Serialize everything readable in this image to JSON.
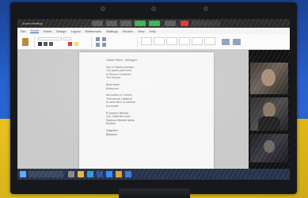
{
  "zoom": {
    "meeting_title": "Zoom Meeting",
    "controls": [
      "mute-icon",
      "video-icon",
      "participants-icon",
      "share-screen-icon",
      "record-icon",
      "end-icon"
    ],
    "colors": {
      "share": "#2fb34a",
      "end": "#d9362b",
      "bar": "#2a2a2a"
    }
  },
  "word": {
    "tabs": [
      "File",
      "Home",
      "Insert",
      "Design",
      "Layout",
      "References",
      "Mailings",
      "Review",
      "View",
      "Help"
    ],
    "active_tab": "Home",
    "document_lines": [
      "Cillard Street , Mettogen . .",
      "",
      "Sun in Winternoonsse",
      "Tue yarun paid nrno",
      "le Stivon e sunbeen",
      "The lulli pla",
      "",
      "Boarunber",
      "Mnbunum",
      "",
      "Ant lustion e 4 seem",
      "Thenweore j latlas te",
      "ie seuri ekrs, in edshas",
      "Ica sumle .",
      "",
      "Pi psesen ffbehss",
      "Lec, mwerdrn tuoel",
      "Slaennn Mierlert Iarles",
      "Emeles",
      "",
      "Dtsanline",
      "Bilanens"
    ]
  },
  "participants": [
    {
      "name": "",
      "icon": "person-video-tile"
    },
    {
      "name": "",
      "icon": "person-video-tile"
    },
    {
      "name": "",
      "icon": "person-video-tile"
    }
  ],
  "taskbar": {
    "icons": [
      "windows-start-icon",
      "search-box",
      "task-view-icon",
      "file-explorer-icon",
      "edge-icon",
      "word-icon",
      "zoom-icon",
      "chrome-icon"
    ],
    "time": "",
    "date": ""
  }
}
